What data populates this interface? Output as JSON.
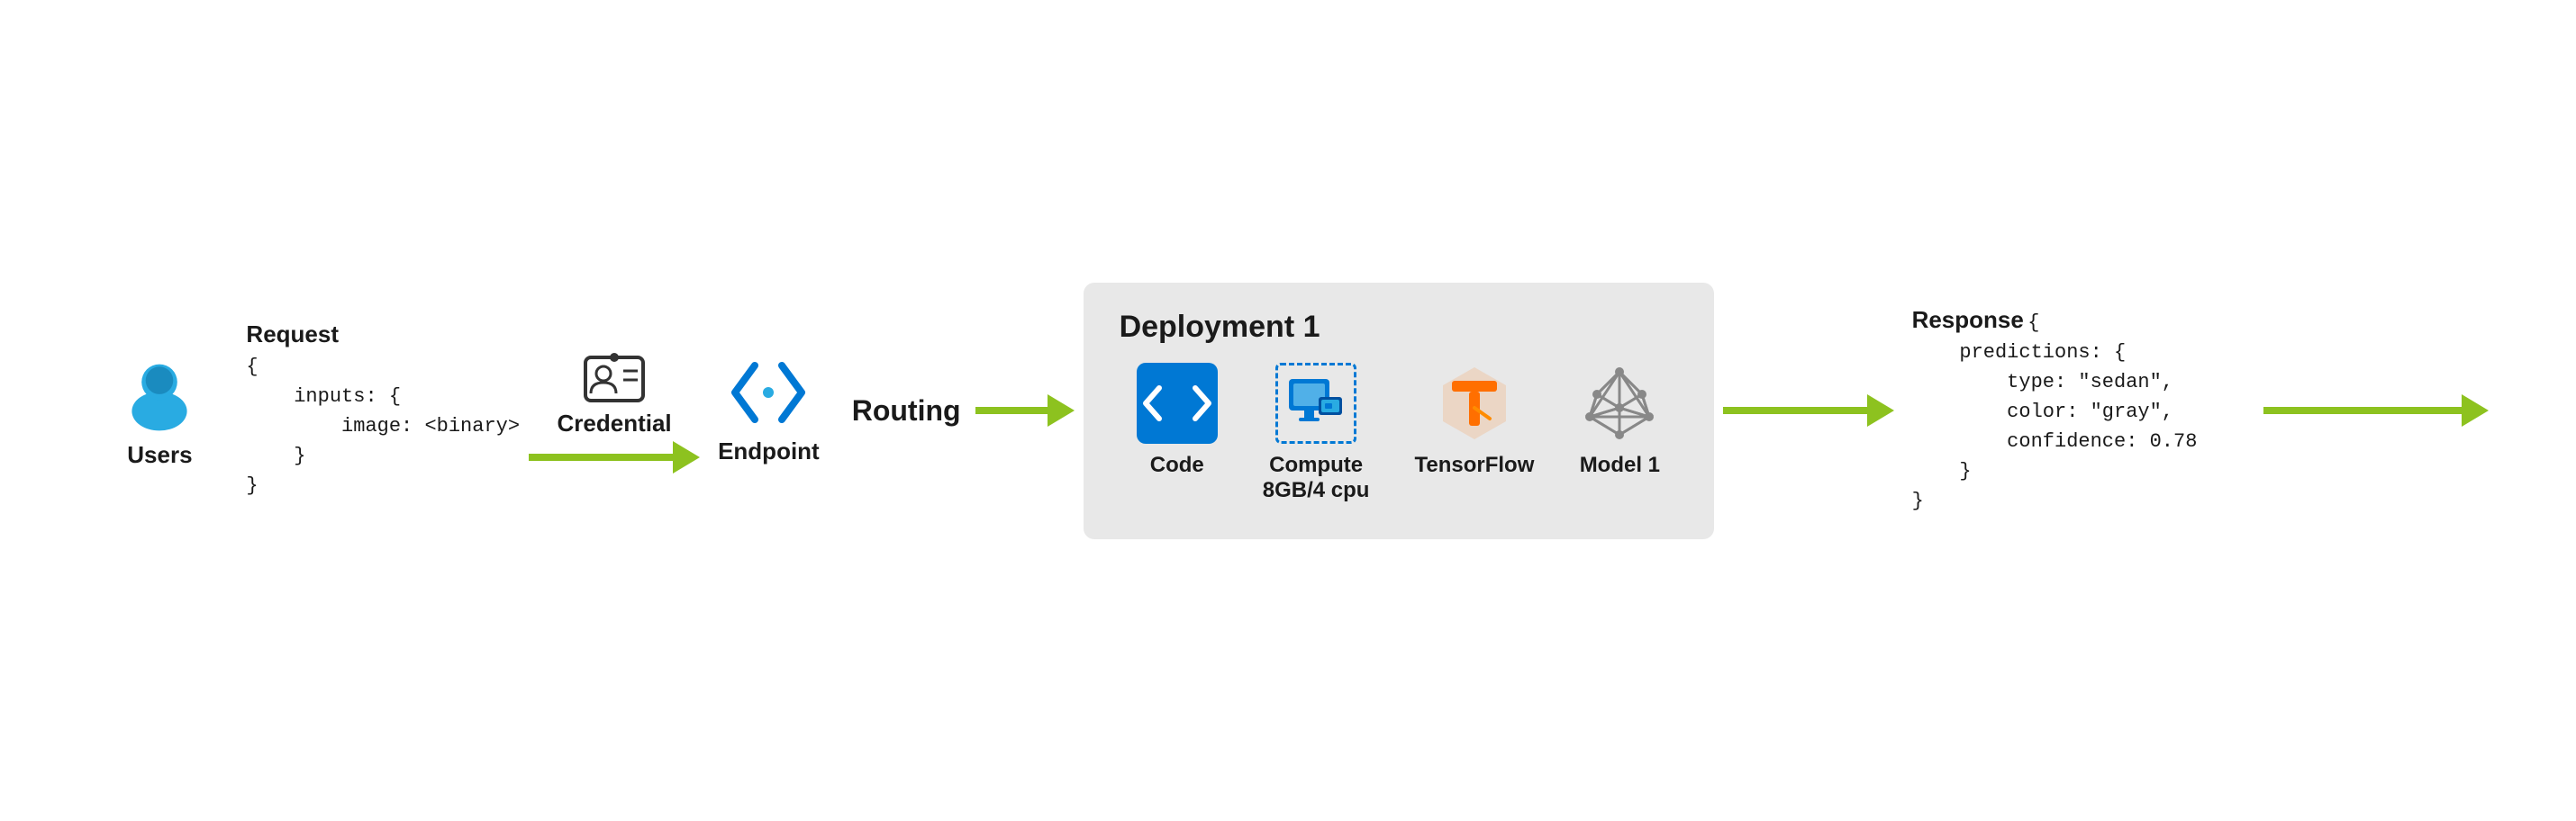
{
  "users": {
    "label": "Users"
  },
  "request": {
    "label": "Request",
    "code": "{\n    inputs: {\n        image: <binary>\n    }\n}"
  },
  "credential": {
    "label": "Credential"
  },
  "endpoint": {
    "label": "Endpoint"
  },
  "routing": {
    "label": "Routing"
  },
  "deployment": {
    "title": "Deployment 1",
    "items": [
      {
        "id": "code",
        "label": "Code"
      },
      {
        "id": "compute",
        "label": "Compute\n8GB/4 cpu"
      },
      {
        "id": "tensorflow",
        "label": "TensorFlow"
      },
      {
        "id": "model1",
        "label": "Model 1"
      }
    ]
  },
  "response": {
    "label": "Response",
    "code": "{\n    predictions: {\n        type: \"sedan\",\n        color: \"gray\",\n        confidence: 0.78\n    }\n}"
  },
  "colors": {
    "arrow": "#8dc21f",
    "azure_blue": "#0078d4",
    "tf_orange": "#FF6F00",
    "model_gray": "#888888",
    "code_blue": "#0078d4",
    "text_dark": "#1a1a1a",
    "deployment_bg": "#e0e0e0"
  }
}
